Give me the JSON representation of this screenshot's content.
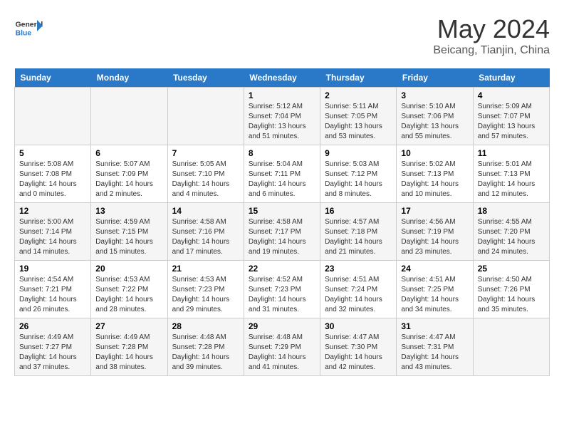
{
  "header": {
    "logo_general": "General",
    "logo_blue": "Blue",
    "month_title": "May 2024",
    "location": "Beicang, Tianjin, China"
  },
  "weekdays": [
    "Sunday",
    "Monday",
    "Tuesday",
    "Wednesday",
    "Thursday",
    "Friday",
    "Saturday"
  ],
  "weeks": [
    [
      {
        "day": "",
        "sunrise": "",
        "sunset": "",
        "daylight": ""
      },
      {
        "day": "",
        "sunrise": "",
        "sunset": "",
        "daylight": ""
      },
      {
        "day": "",
        "sunrise": "",
        "sunset": "",
        "daylight": ""
      },
      {
        "day": "1",
        "sunrise": "5:12 AM",
        "sunset": "7:04 PM",
        "daylight": "13 hours and 51 minutes."
      },
      {
        "day": "2",
        "sunrise": "5:11 AM",
        "sunset": "7:05 PM",
        "daylight": "13 hours and 53 minutes."
      },
      {
        "day": "3",
        "sunrise": "5:10 AM",
        "sunset": "7:06 PM",
        "daylight": "13 hours and 55 minutes."
      },
      {
        "day": "4",
        "sunrise": "5:09 AM",
        "sunset": "7:07 PM",
        "daylight": "13 hours and 57 minutes."
      }
    ],
    [
      {
        "day": "5",
        "sunrise": "5:08 AM",
        "sunset": "7:08 PM",
        "daylight": "14 hours and 0 minutes."
      },
      {
        "day": "6",
        "sunrise": "5:07 AM",
        "sunset": "7:09 PM",
        "daylight": "14 hours and 2 minutes."
      },
      {
        "day": "7",
        "sunrise": "5:05 AM",
        "sunset": "7:10 PM",
        "daylight": "14 hours and 4 minutes."
      },
      {
        "day": "8",
        "sunrise": "5:04 AM",
        "sunset": "7:11 PM",
        "daylight": "14 hours and 6 minutes."
      },
      {
        "day": "9",
        "sunrise": "5:03 AM",
        "sunset": "7:12 PM",
        "daylight": "14 hours and 8 minutes."
      },
      {
        "day": "10",
        "sunrise": "5:02 AM",
        "sunset": "7:13 PM",
        "daylight": "14 hours and 10 minutes."
      },
      {
        "day": "11",
        "sunrise": "5:01 AM",
        "sunset": "7:13 PM",
        "daylight": "14 hours and 12 minutes."
      }
    ],
    [
      {
        "day": "12",
        "sunrise": "5:00 AM",
        "sunset": "7:14 PM",
        "daylight": "14 hours and 14 minutes."
      },
      {
        "day": "13",
        "sunrise": "4:59 AM",
        "sunset": "7:15 PM",
        "daylight": "14 hours and 15 minutes."
      },
      {
        "day": "14",
        "sunrise": "4:58 AM",
        "sunset": "7:16 PM",
        "daylight": "14 hours and 17 minutes."
      },
      {
        "day": "15",
        "sunrise": "4:58 AM",
        "sunset": "7:17 PM",
        "daylight": "14 hours and 19 minutes."
      },
      {
        "day": "16",
        "sunrise": "4:57 AM",
        "sunset": "7:18 PM",
        "daylight": "14 hours and 21 minutes."
      },
      {
        "day": "17",
        "sunrise": "4:56 AM",
        "sunset": "7:19 PM",
        "daylight": "14 hours and 23 minutes."
      },
      {
        "day": "18",
        "sunrise": "4:55 AM",
        "sunset": "7:20 PM",
        "daylight": "14 hours and 24 minutes."
      }
    ],
    [
      {
        "day": "19",
        "sunrise": "4:54 AM",
        "sunset": "7:21 PM",
        "daylight": "14 hours and 26 minutes."
      },
      {
        "day": "20",
        "sunrise": "4:53 AM",
        "sunset": "7:22 PM",
        "daylight": "14 hours and 28 minutes."
      },
      {
        "day": "21",
        "sunrise": "4:53 AM",
        "sunset": "7:23 PM",
        "daylight": "14 hours and 29 minutes."
      },
      {
        "day": "22",
        "sunrise": "4:52 AM",
        "sunset": "7:23 PM",
        "daylight": "14 hours and 31 minutes."
      },
      {
        "day": "23",
        "sunrise": "4:51 AM",
        "sunset": "7:24 PM",
        "daylight": "14 hours and 32 minutes."
      },
      {
        "day": "24",
        "sunrise": "4:51 AM",
        "sunset": "7:25 PM",
        "daylight": "14 hours and 34 minutes."
      },
      {
        "day": "25",
        "sunrise": "4:50 AM",
        "sunset": "7:26 PM",
        "daylight": "14 hours and 35 minutes."
      }
    ],
    [
      {
        "day": "26",
        "sunrise": "4:49 AM",
        "sunset": "7:27 PM",
        "daylight": "14 hours and 37 minutes."
      },
      {
        "day": "27",
        "sunrise": "4:49 AM",
        "sunset": "7:28 PM",
        "daylight": "14 hours and 38 minutes."
      },
      {
        "day": "28",
        "sunrise": "4:48 AM",
        "sunset": "7:28 PM",
        "daylight": "14 hours and 39 minutes."
      },
      {
        "day": "29",
        "sunrise": "4:48 AM",
        "sunset": "7:29 PM",
        "daylight": "14 hours and 41 minutes."
      },
      {
        "day": "30",
        "sunrise": "4:47 AM",
        "sunset": "7:30 PM",
        "daylight": "14 hours and 42 minutes."
      },
      {
        "day": "31",
        "sunrise": "4:47 AM",
        "sunset": "7:31 PM",
        "daylight": "14 hours and 43 minutes."
      },
      {
        "day": "",
        "sunrise": "",
        "sunset": "",
        "daylight": ""
      }
    ]
  ]
}
